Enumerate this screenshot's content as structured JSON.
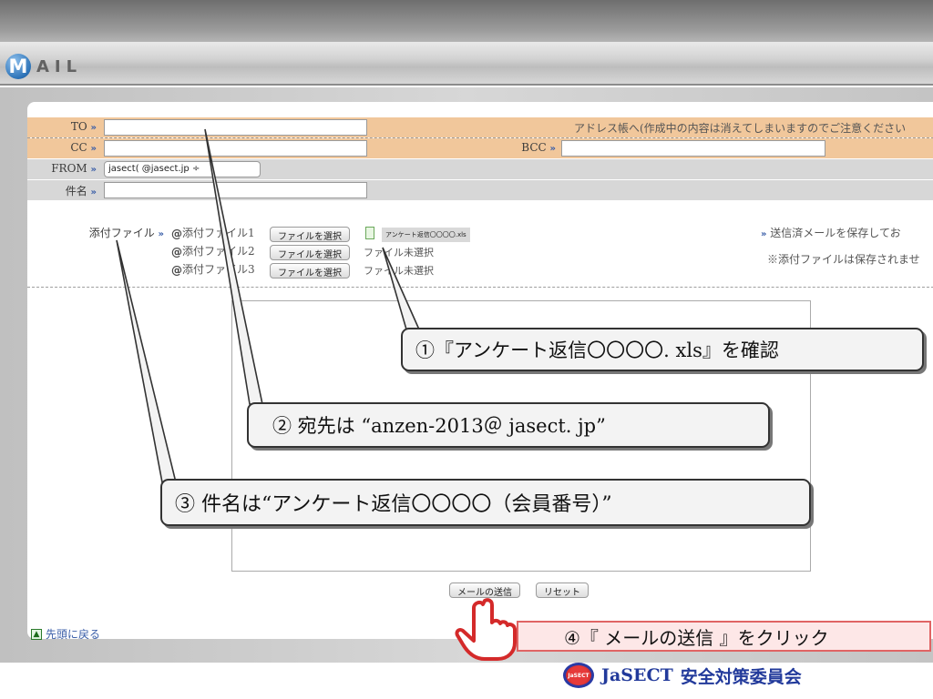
{
  "header": {
    "logo_initial": "M",
    "logo_rest": "AIL"
  },
  "form": {
    "to_label": "TO",
    "cc_label": "CC",
    "bcc_label": "BCC",
    "from_label": "FROM",
    "subject_label": "件名",
    "address_book_text": "アドレス帳へ(作成中の内容は消えてしまいますのでご注意ください",
    "from_value": "jasect(        @jasect.jp  ÷",
    "attach_label": "添付ファイル",
    "attachments": [
      {
        "label": "添付ファイル1",
        "button": "ファイルを選択",
        "status": "アンケート返信〇〇〇〇.xls"
      },
      {
        "label": "添付ファイル2",
        "button": "ファイルを選択",
        "status": "ファイル未選択"
      },
      {
        "label": "添付ファイル3",
        "button": "ファイルを選択",
        "status": "ファイル未選択"
      }
    ],
    "save_sent_text": "送信済メールを保存してお",
    "attach_note": "※添付ファイルは保存されませ",
    "send_button": "メールの送信",
    "reset_button": "リセット"
  },
  "footer": {
    "back_to_top": "先頭に戻る"
  },
  "callouts": {
    "step1": "①『アンケート返信〇〇〇〇. xls』を確認",
    "step2": "② 宛先は “anzen-2013＠ jasect. jp”",
    "step3": "③ 件名は“アンケート返信〇〇〇〇（会員番号）”",
    "step4": "④『 メールの送信 』をクリック"
  },
  "brand": {
    "logo_text": "JaSECT",
    "name_en": "JaSECT",
    "name_jp": "安全対策委員会"
  },
  "colors": {
    "orange_band": "#f1c79b",
    "gray_band": "#d7d7d7",
    "link_blue": "#3a5ea8",
    "brand_blue": "#223a9b",
    "step4_border": "#e06464"
  }
}
